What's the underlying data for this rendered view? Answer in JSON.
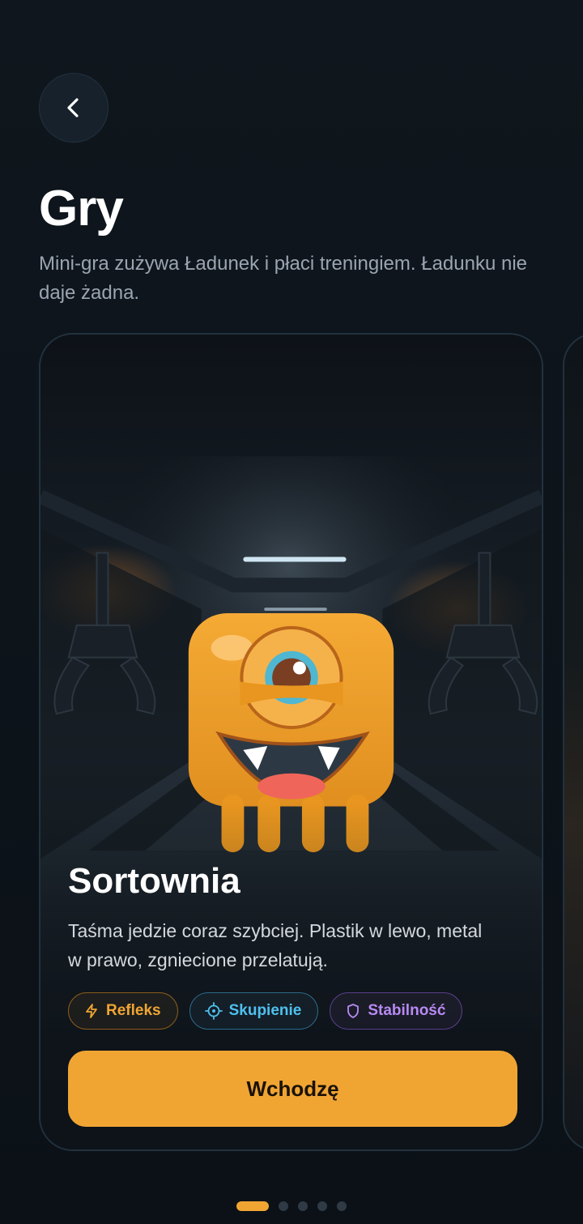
{
  "header": {
    "title": "Gry",
    "subtitle": "Mini-gra zużywa Ładunek i płaci treningiem. Ładunku nie daje żadna."
  },
  "card": {
    "title": "Sortownia",
    "description": "Taśma jedzie coraz szybciej. Plastik w lewo, metal w prawo, zgniecione przelatują.",
    "tags": [
      {
        "label": "Refleks",
        "icon": "lightning-icon",
        "color": "#f0a533"
      },
      {
        "label": "Skupienie",
        "icon": "target-icon",
        "color": "#4fc0ee"
      },
      {
        "label": "Stabilność",
        "icon": "shield-icon",
        "color": "#b88af2"
      }
    ],
    "cta_label": "Wchodzę",
    "mascot": "one-eyed-orange-monster"
  },
  "pagination": {
    "count": 5,
    "active_index": 0
  },
  "colors": {
    "accent": "#f0a533",
    "background": "#0c1218"
  }
}
